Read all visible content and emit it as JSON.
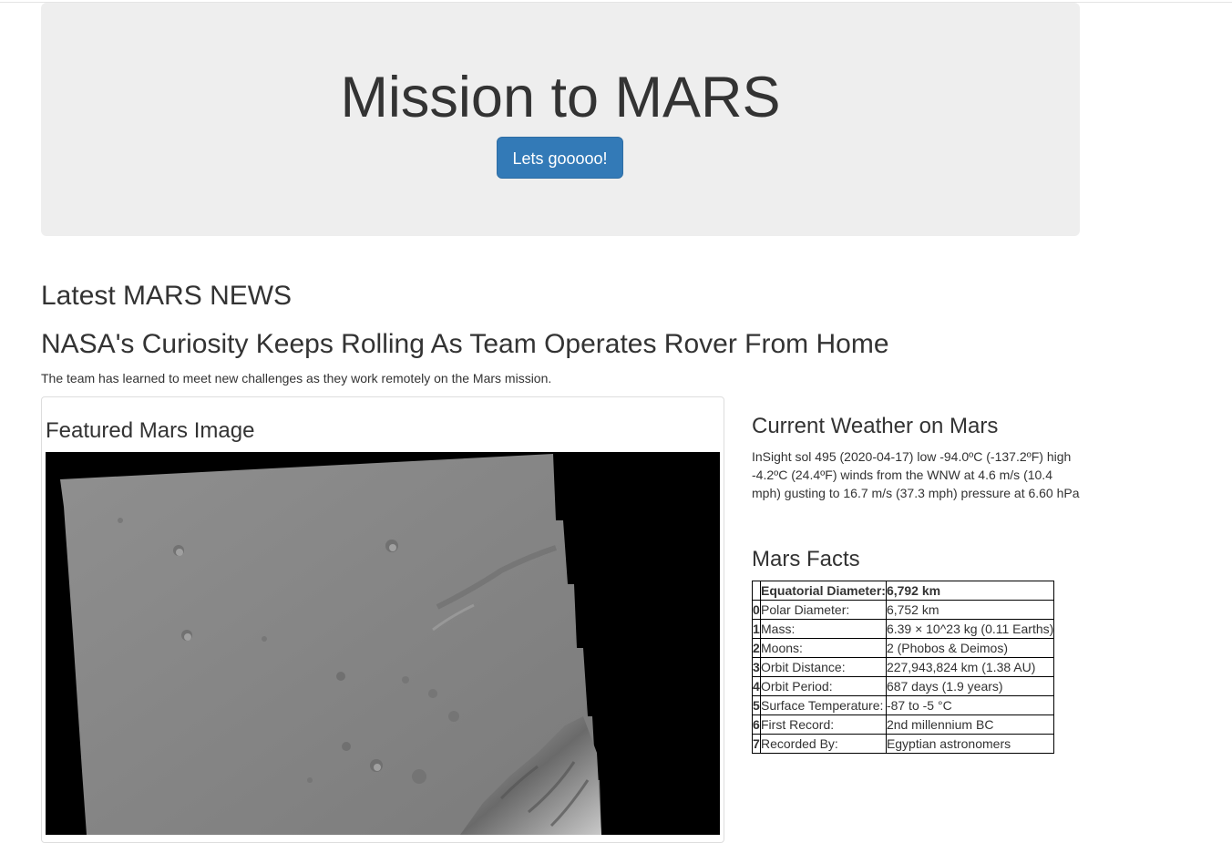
{
  "jumbotron": {
    "title": "Mission to MARS",
    "button_label": "Lets gooooo!",
    "button_color": "#337ab7"
  },
  "news": {
    "section_header": "Latest MARS NEWS",
    "title": "NASA's Curiosity Keeps Rolling As Team Operates Rover From Home",
    "teaser": "The team has learned to meet new challenges as they work remotely on the Mars mission."
  },
  "featured": {
    "header": "Featured Mars Image"
  },
  "weather": {
    "header": "Current Weather on Mars",
    "text": "InSight sol 495 (2020-04-17) low -94.0ºC (-137.2ºF) high -4.2ºC (24.4ºF) winds from the WNW at 4.6 m/s (10.4 mph) gusting to 16.7 m/s (37.3 mph) pressure at 6.60 hPa"
  },
  "facts": {
    "header": "Mars Facts",
    "head_label": "Equatorial Diameter:",
    "head_value": "6,792 km",
    "rows": [
      {
        "idx": "0",
        "label": "Polar Diameter:",
        "value": "6,752 km"
      },
      {
        "idx": "1",
        "label": "Mass:",
        "value": "6.39 × 10^23 kg (0.11 Earths)"
      },
      {
        "idx": "2",
        "label": "Moons:",
        "value": "2 (Phobos & Deimos)"
      },
      {
        "idx": "3",
        "label": "Orbit Distance:",
        "value": "227,943,824 km (1.38 AU)"
      },
      {
        "idx": "4",
        "label": "Orbit Period:",
        "value": "687 days (1.9 years)"
      },
      {
        "idx": "5",
        "label": "Surface Temperature:",
        "value": "-87 to -5 °C"
      },
      {
        "idx": "6",
        "label": "First Record:",
        "value": "2nd millennium BC"
      },
      {
        "idx": "7",
        "label": "Recorded By:",
        "value": "Egyptian astronomers"
      }
    ]
  }
}
